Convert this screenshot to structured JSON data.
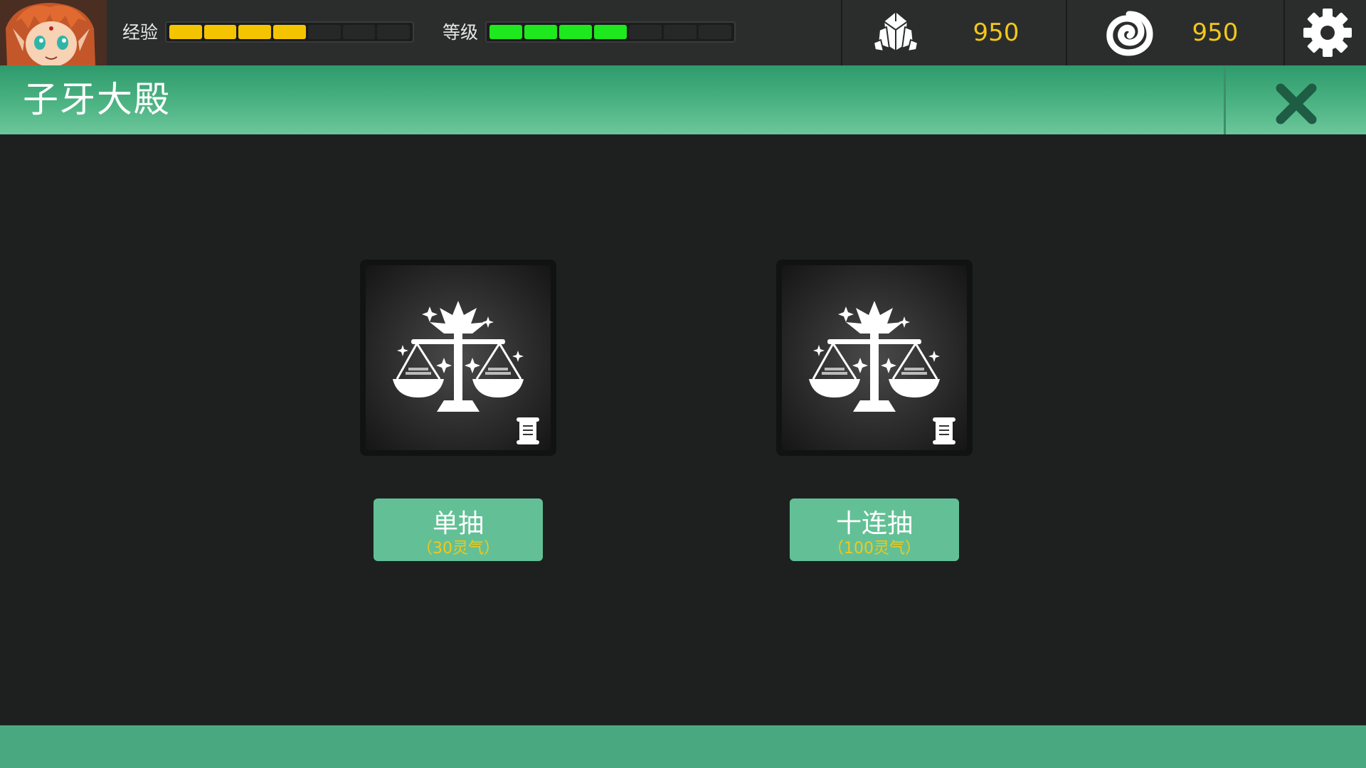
{
  "topbar": {
    "exp": {
      "label": "经验",
      "filled": 4,
      "total": 7
    },
    "level": {
      "label": "等级",
      "filled": 4,
      "total": 7
    },
    "resources": [
      {
        "icon": "crystal-icon",
        "value": "950"
      },
      {
        "icon": "spiral-cloud-icon",
        "value": "950"
      }
    ],
    "settings_icon": "gear-icon"
  },
  "header": {
    "title": "子牙大殿",
    "close_icon": "close-icon"
  },
  "draws": [
    {
      "icon": "scales-icon",
      "badge_icon": "scroll-icon",
      "label": "单抽",
      "cost": "（30灵气）"
    },
    {
      "icon": "scales-icon",
      "badge_icon": "scroll-icon",
      "label": "十连抽",
      "cost": "（100灵气）"
    }
  ],
  "colors": {
    "exp_bar": "#f5c400",
    "level_bar": "#1ee81e",
    "accent_green": "#4cb383",
    "button_green": "#63c096",
    "currency_text": "#f2c81a"
  }
}
